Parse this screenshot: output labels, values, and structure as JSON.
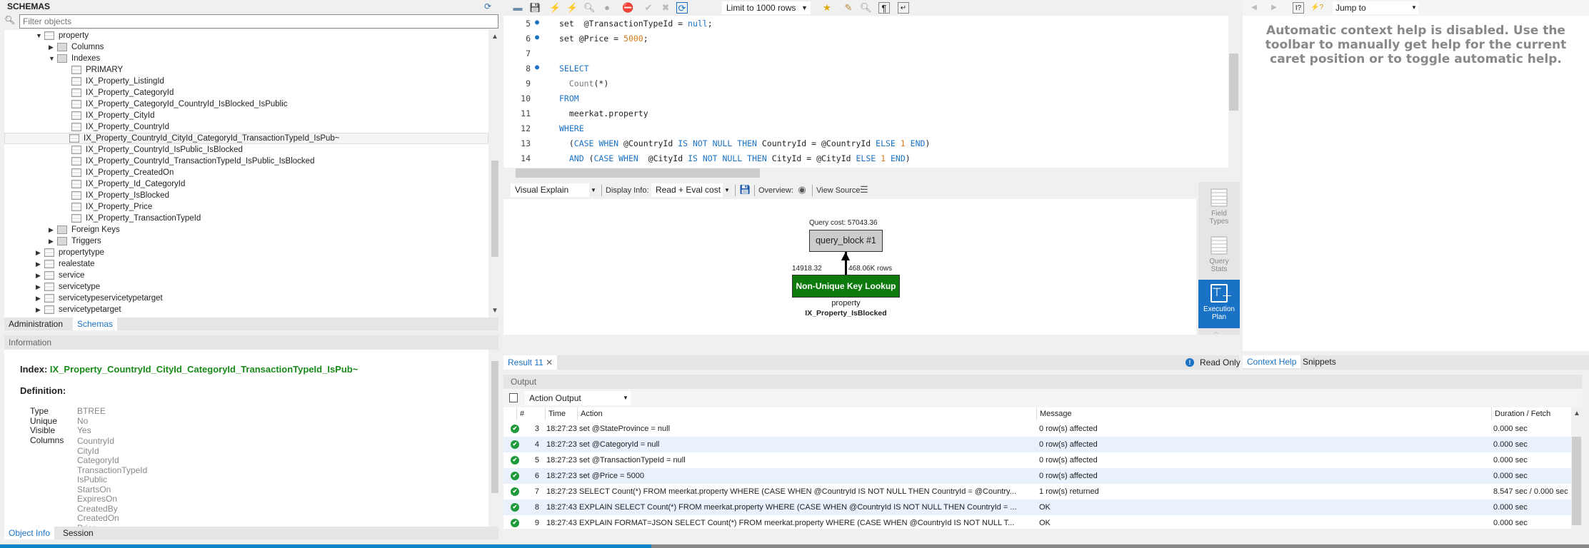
{
  "schemas": {
    "title": "SCHEMAS",
    "filter_placeholder": "Filter objects",
    "tree": [
      {
        "label": "property",
        "level": 0,
        "toggle": "▼",
        "icon": "table"
      },
      {
        "label": "Columns",
        "level": 1,
        "toggle": "▶",
        "icon": "folder"
      },
      {
        "label": "Indexes",
        "level": 1,
        "toggle": "▼",
        "icon": "folder"
      },
      {
        "label": "PRIMARY",
        "level": 2,
        "toggle": "",
        "icon": "index"
      },
      {
        "label": "IX_Property_ListingId",
        "level": 2,
        "toggle": "",
        "icon": "index"
      },
      {
        "label": "IX_Property_CategoryId",
        "level": 2,
        "toggle": "",
        "icon": "index"
      },
      {
        "label": "IX_Property_CategoryId_CountryId_IsBlocked_IsPublic",
        "level": 2,
        "toggle": "",
        "icon": "index"
      },
      {
        "label": "IX_Property_CityId",
        "level": 2,
        "toggle": "",
        "icon": "index"
      },
      {
        "label": "IX_Property_CountryId",
        "level": 2,
        "toggle": "",
        "icon": "index"
      },
      {
        "label": "IX_Property_CountryId_CityId_CategoryId_TransactionTypeId_IsPub~",
        "level": 2,
        "toggle": "",
        "icon": "index",
        "selected": true
      },
      {
        "label": "IX_Property_CountryId_IsPublic_IsBlocked",
        "level": 2,
        "toggle": "",
        "icon": "index"
      },
      {
        "label": "IX_Property_CountryId_TransactionTypeId_IsPublic_IsBlocked",
        "level": 2,
        "toggle": "",
        "icon": "index"
      },
      {
        "label": "IX_Property_CreatedOn",
        "level": 2,
        "toggle": "",
        "icon": "index"
      },
      {
        "label": "IX_Property_Id_CategoryId",
        "level": 2,
        "toggle": "",
        "icon": "index"
      },
      {
        "label": "IX_Property_IsBlocked",
        "level": 2,
        "toggle": "",
        "icon": "index"
      },
      {
        "label": "IX_Property_Price",
        "level": 2,
        "toggle": "",
        "icon": "index"
      },
      {
        "label": "IX_Property_TransactionTypeId",
        "level": 2,
        "toggle": "",
        "icon": "index"
      },
      {
        "label": "Foreign Keys",
        "level": 1,
        "toggle": "▶",
        "icon": "folder"
      },
      {
        "label": "Triggers",
        "level": 1,
        "toggle": "▶",
        "icon": "folder"
      },
      {
        "label": "propertytype",
        "level": 0,
        "toggle": "▶",
        "icon": "table"
      },
      {
        "label": "realestate",
        "level": 0,
        "toggle": "▶",
        "icon": "table"
      },
      {
        "label": "service",
        "level": 0,
        "toggle": "▶",
        "icon": "table"
      },
      {
        "label": "servicetype",
        "level": 0,
        "toggle": "▶",
        "icon": "table"
      },
      {
        "label": "servicetypeservicetypetarget",
        "level": 0,
        "toggle": "▶",
        "icon": "table"
      },
      {
        "label": "servicetypetarget",
        "level": 0,
        "toggle": "▶",
        "icon": "table"
      }
    ],
    "tabs": [
      "Administration",
      "Schemas"
    ],
    "active_tab": "Schemas"
  },
  "information": {
    "header": "Information",
    "index_label": "Index:",
    "index_name": "IX_Property_CountryId_CityId_CategoryId_TransactionTypeId_IsPub~",
    "definition_label": "Definition:",
    "type_label": "Type",
    "type_value": "BTREE",
    "unique_label": "Unique",
    "unique_value": "No",
    "visible_label": "Visible",
    "visible_value": "Yes",
    "columns_label": "Columns",
    "columns": [
      "CountryId",
      "CityId",
      "CategoryId",
      "TransactionTypeId",
      "IsPublic",
      "StartsOn",
      "ExpiresOn",
      "CreatedBy",
      "CreatedOn",
      "Price"
    ],
    "tabs": [
      "Object Info",
      "Session"
    ],
    "active_tab": "Object Info"
  },
  "toolbar": {
    "limit_rows": "Limit to 1000 rows"
  },
  "editor": {
    "lines": [
      {
        "n": "5",
        "dot": true,
        "html": "set  @TransactionTypeId = <span class='kw'>null</span>;"
      },
      {
        "n": "6",
        "dot": true,
        "html": "set @Price = <span class='num'>5000</span>;"
      },
      {
        "n": "7",
        "dot": false,
        "html": ""
      },
      {
        "n": "8",
        "dot": true,
        "html": "<span class='kw'>SELECT</span>"
      },
      {
        "n": "9",
        "dot": false,
        "html": "  <span class='fn'>Count</span>(*)"
      },
      {
        "n": "10",
        "dot": false,
        "html": "<span class='kw'>FROM</span>"
      },
      {
        "n": "11",
        "dot": false,
        "html": "  meerkat.property"
      },
      {
        "n": "12",
        "dot": false,
        "html": "<span class='kw'>WHERE</span>"
      },
      {
        "n": "13",
        "dot": false,
        "html": "  (<span class='kw'>CASE WHEN</span> @CountryId <span class='kw'>IS NOT NULL THEN</span> CountryId = @CountryId <span class='kw'>ELSE</span> <span class='num'>1</span> <span class='kw'>END</span>)"
      },
      {
        "n": "14",
        "dot": false,
        "html": "  <span class='kw'>AND</span> (<span class='kw'>CASE WHEN</span>  @CityId <span class='kw'>IS NOT NULL THEN</span> CityId = @CityId <span class='kw'>ELSE</span> <span class='num'>1</span> <span class='kw'>END</span>)"
      }
    ]
  },
  "explain": {
    "view_mode": "Visual Explain",
    "display_info_label": "Display Info:",
    "display_info_value": "Read + Eval cost",
    "overview_label": "Overview:",
    "view_source_label": "View Source:",
    "query_cost": "Query cost: 57043.36",
    "query_block": "query_block #1",
    "edge_cost": "14918.32",
    "edge_rows": "468.06K rows",
    "access_type": "Non-Unique Key Lookup",
    "table": "property",
    "index": "IX_Property_IsBlocked",
    "access_color": "#0c7a0c"
  },
  "side_panel": [
    {
      "label1": "Field",
      "label2": "Types",
      "active": false
    },
    {
      "label1": "Query",
      "label2": "Stats",
      "active": false
    },
    {
      "label1": "Execution",
      "label2": "Plan",
      "active": true
    }
  ],
  "results": {
    "tab_label": "Result 11",
    "read_only": "Read Only"
  },
  "right_panel": {
    "jump_to": "Jump to",
    "help_text": "Automatic context help is disabled. Use the toolbar to manually get help for the current caret position or to toggle automatic help.",
    "tabs": [
      "Context Help",
      "Snippets"
    ],
    "active_tab": "Context Help"
  },
  "output": {
    "header": "Output",
    "mode": "Action Output",
    "columns": [
      "#",
      "Time",
      "Action",
      "Message",
      "Duration / Fetch"
    ],
    "rows": [
      {
        "n": "3",
        "time": "18:27:23",
        "action": "set @StateProvince = null",
        "message": "0 row(s) affected",
        "duration": "0.000 sec"
      },
      {
        "n": "4",
        "time": "18:27:23",
        "action": "set @CategoryId = null",
        "message": "0 row(s) affected",
        "duration": "0.000 sec"
      },
      {
        "n": "5",
        "time": "18:27:23",
        "action": "set  @TransactionTypeId = null",
        "message": "0 row(s) affected",
        "duration": "0.000 sec"
      },
      {
        "n": "6",
        "time": "18:27:23",
        "action": "set @Price = 5000",
        "message": "0 row(s) affected",
        "duration": "0.000 sec"
      },
      {
        "n": "7",
        "time": "18:27:23",
        "action": "SELECT   Count(*)  FROM   meerkat.property  WHERE   (CASE WHEN @CountryId IS NOT NULL THEN CountryId = @Country...",
        "message": "1 row(s) returned",
        "duration": "8.547 sec / 0.000 sec"
      },
      {
        "n": "8",
        "time": "18:27:43",
        "action": "EXPLAIN SELECT   Count(*)  FROM   meerkat.property  WHERE   (CASE WHEN @CountryId IS NOT NULL THEN CountryId = ...",
        "message": "OK",
        "duration": "0.000 sec"
      },
      {
        "n": "9",
        "time": "18:27:43",
        "action": "EXPLAIN FORMAT=JSON SELECT   Count(*)  FROM   meerkat.property  WHERE   (CASE WHEN @CountryId IS NOT NULL T...",
        "message": "OK",
        "duration": "0.000 sec"
      }
    ]
  },
  "status": {
    "progress_percent": 41
  }
}
